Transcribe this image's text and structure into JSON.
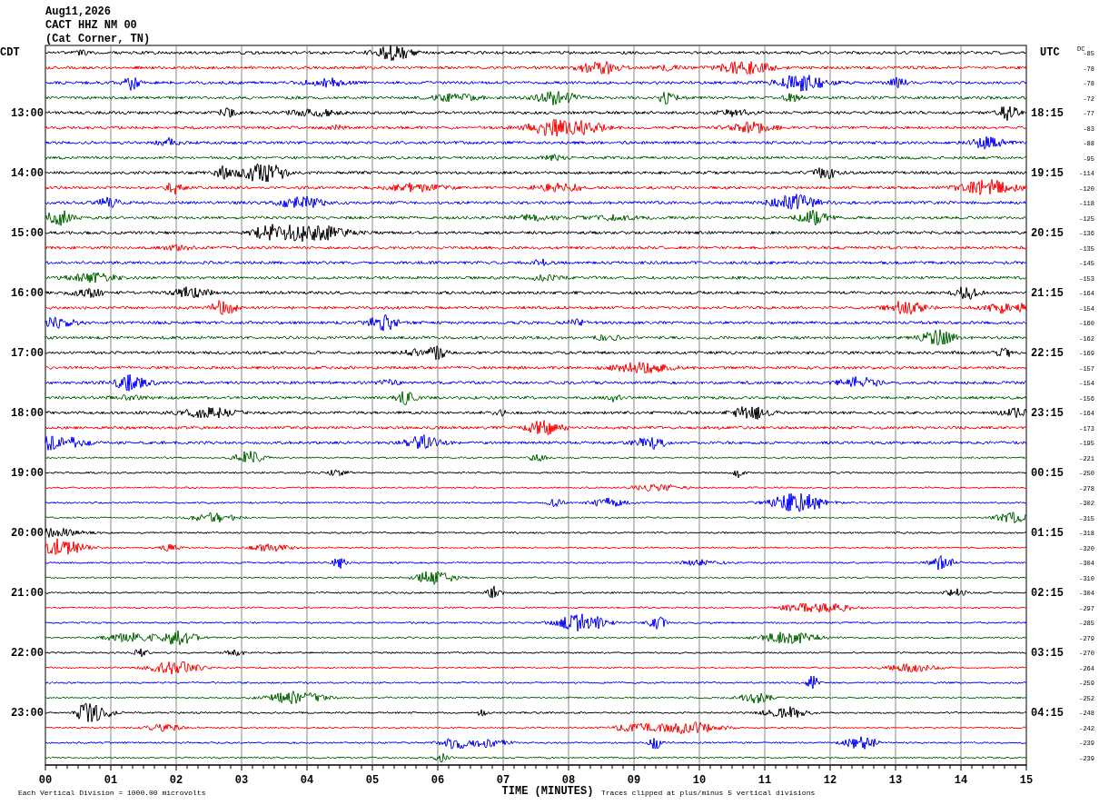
{
  "header": [
    "Aug11,2026",
    "CACT HHZ NM 00",
    "(Cat Corner, TN)"
  ],
  "left_zone": "CDT",
  "right_zone": "UTC",
  "dc_label": "DC",
  "traces": [
    {
      "color": "#000000",
      "dc": "-85"
    },
    {
      "color": "#ff0000",
      "dc": "-78"
    },
    {
      "color": "#0000ff",
      "dc": "-78"
    },
    {
      "color": "#006400",
      "dc": "-72"
    },
    {
      "color": "#000000",
      "dc": "-77",
      "local": "13:00",
      "utc": "18:15"
    },
    {
      "color": "#ff0000",
      "dc": "-83"
    },
    {
      "color": "#0000ff",
      "dc": "-88"
    },
    {
      "color": "#006400",
      "dc": "-95"
    },
    {
      "color": "#000000",
      "dc": "-114",
      "local": "14:00",
      "utc": "19:15"
    },
    {
      "color": "#ff0000",
      "dc": "-120"
    },
    {
      "color": "#0000ff",
      "dc": "-118"
    },
    {
      "color": "#006400",
      "dc": "-125"
    },
    {
      "color": "#000000",
      "dc": "-136",
      "local": "15:00",
      "utc": "20:15"
    },
    {
      "color": "#ff0000",
      "dc": "-135"
    },
    {
      "color": "#0000ff",
      "dc": "-145"
    },
    {
      "color": "#006400",
      "dc": "-153"
    },
    {
      "color": "#000000",
      "dc": "-164",
      "local": "16:00",
      "utc": "21:15"
    },
    {
      "color": "#ff0000",
      "dc": "-154"
    },
    {
      "color": "#0000ff",
      "dc": "-160"
    },
    {
      "color": "#006400",
      "dc": "-162"
    },
    {
      "color": "#000000",
      "dc": "-169",
      "local": "17:00",
      "utc": "22:15"
    },
    {
      "color": "#ff0000",
      "dc": "-157"
    },
    {
      "color": "#0000ff",
      "dc": "-154"
    },
    {
      "color": "#006400",
      "dc": "-156"
    },
    {
      "color": "#000000",
      "dc": "-164",
      "local": "18:00",
      "utc": "23:15"
    },
    {
      "color": "#ff0000",
      "dc": "-173"
    },
    {
      "color": "#0000ff",
      "dc": "-195"
    },
    {
      "color": "#006400",
      "dc": "-221"
    },
    {
      "color": "#000000",
      "dc": "-250",
      "local": "19:00",
      "utc": "00:15"
    },
    {
      "color": "#ff0000",
      "dc": "-278"
    },
    {
      "color": "#0000ff",
      "dc": "-302"
    },
    {
      "color": "#006400",
      "dc": "-315"
    },
    {
      "color": "#000000",
      "dc": "-318",
      "local": "20:00",
      "utc": "01:15"
    },
    {
      "color": "#ff0000",
      "dc": "-320"
    },
    {
      "color": "#0000ff",
      "dc": "-304"
    },
    {
      "color": "#006400",
      "dc": "-310"
    },
    {
      "color": "#000000",
      "dc": "-304",
      "local": "21:00",
      "utc": "02:15"
    },
    {
      "color": "#ff0000",
      "dc": "-297"
    },
    {
      "color": "#0000ff",
      "dc": "-285"
    },
    {
      "color": "#006400",
      "dc": "-279"
    },
    {
      "color": "#000000",
      "dc": "-270",
      "local": "22:00",
      "utc": "03:15"
    },
    {
      "color": "#ff0000",
      "dc": "-264"
    },
    {
      "color": "#0000ff",
      "dc": "-259"
    },
    {
      "color": "#006400",
      "dc": "-252"
    },
    {
      "color": "#000000",
      "dc": "-248",
      "local": "23:00",
      "utc": "04:15"
    },
    {
      "color": "#ff0000",
      "dc": "-242"
    },
    {
      "color": "#0000ff",
      "dc": "-239"
    },
    {
      "color": "#006400",
      "dc": "-239"
    }
  ],
  "x_ticks": [
    "00",
    "01",
    "02",
    "03",
    "04",
    "05",
    "06",
    "07",
    "08",
    "09",
    "10",
    "11",
    "12",
    "13",
    "14",
    "15"
  ],
  "xlabel": "TIME (MINUTES)",
  "scale_note": "Each Vertical Division = 1000.00 microvolts",
  "clip_note": "Traces clipped at plus/minus 5 vertical divisions"
}
